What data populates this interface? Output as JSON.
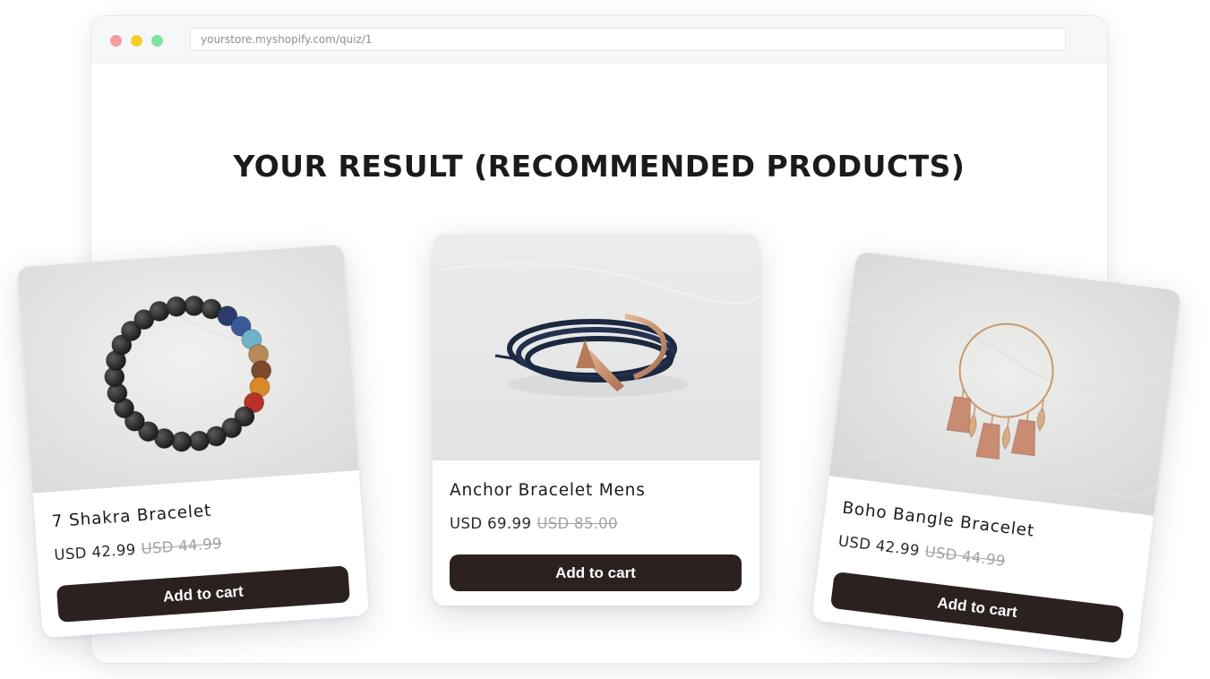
{
  "browser": {
    "url": "yourstore.myshopify.com/quiz/1"
  },
  "page": {
    "title": "YOUR RESULT (RECOMMENDED PRODUCTS)"
  },
  "products": [
    {
      "name": "7 Shakra Bracelet",
      "price": "USD 42.99",
      "compare_price": "USD 44.99",
      "button_label": "Add to cart",
      "image_icon": "beaded-bracelet-icon"
    },
    {
      "name": "Anchor Bracelet Mens",
      "price": "USD 69.99",
      "compare_price": "USD 85.00",
      "button_label": "Add to cart",
      "image_icon": "anchor-bracelet-icon"
    },
    {
      "name": "Boho Bangle Bracelet",
      "price": "USD 42.99",
      "compare_price": "USD 44.99",
      "button_label": "Add to cart",
      "image_icon": "tassel-bangle-icon"
    }
  ],
  "colors": {
    "button": "#2b2220",
    "title": "#1b1b1b",
    "compare_price": "#a3a3a3"
  }
}
